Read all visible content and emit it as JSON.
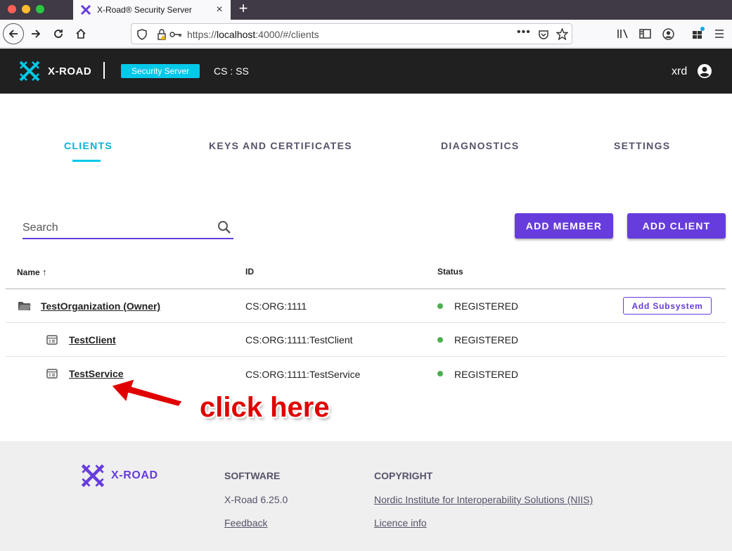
{
  "browser": {
    "tab_title": "X-Road® Security Server",
    "url_prefix": "https://",
    "url_host": "localhost",
    "url_rest": ":4000/#/clients",
    "new_tab": "+",
    "close": "×"
  },
  "header": {
    "logo_text": "X-ROAD",
    "server_badge": "Security Server",
    "server_id": "CS : SS",
    "user": "xrd"
  },
  "tabs": [
    {
      "label": "CLIENTS",
      "active": true
    },
    {
      "label": "KEYS AND CERTIFICATES",
      "active": false
    },
    {
      "label": "DIAGNOSTICS",
      "active": false
    },
    {
      "label": "SETTINGS",
      "active": false
    }
  ],
  "search": {
    "placeholder": "Search",
    "value": ""
  },
  "actions": {
    "add_member": "ADD MEMBER",
    "add_client": "ADD CLIENT"
  },
  "table": {
    "columns": {
      "name": "Name",
      "id": "ID",
      "status": "Status"
    },
    "sort_arrow": "↑",
    "rows": [
      {
        "name": "TestOrganization (Owner)",
        "id": "CS:ORG:1111",
        "status": "REGISTERED",
        "action": "Add Subsystem",
        "icon": "folder-icon"
      },
      {
        "name": "TestClient",
        "id": "CS:ORG:1111:TestClient",
        "status": "REGISTERED",
        "icon": "subsystem-icon"
      },
      {
        "name": "TestService",
        "id": "CS:ORG:1111:TestService",
        "status": "REGISTERED",
        "icon": "subsystem-icon"
      }
    ]
  },
  "annotation": {
    "text": "click here",
    "color": "#e00000"
  },
  "footer": {
    "logo_text": "X-ROAD",
    "software_heading": "SOFTWARE",
    "version": "X-Road 6.25.0",
    "feedback": "Feedback",
    "copyright_heading": "COPYRIGHT",
    "niis": "Nordic Institute for Interoperability Solutions (NIIS)",
    "licence": "Licence info"
  },
  "colors": {
    "accent": "#663cdc",
    "cyan": "#00c9e9",
    "status_ok": "#4caf50",
    "header_bg": "#202020"
  }
}
